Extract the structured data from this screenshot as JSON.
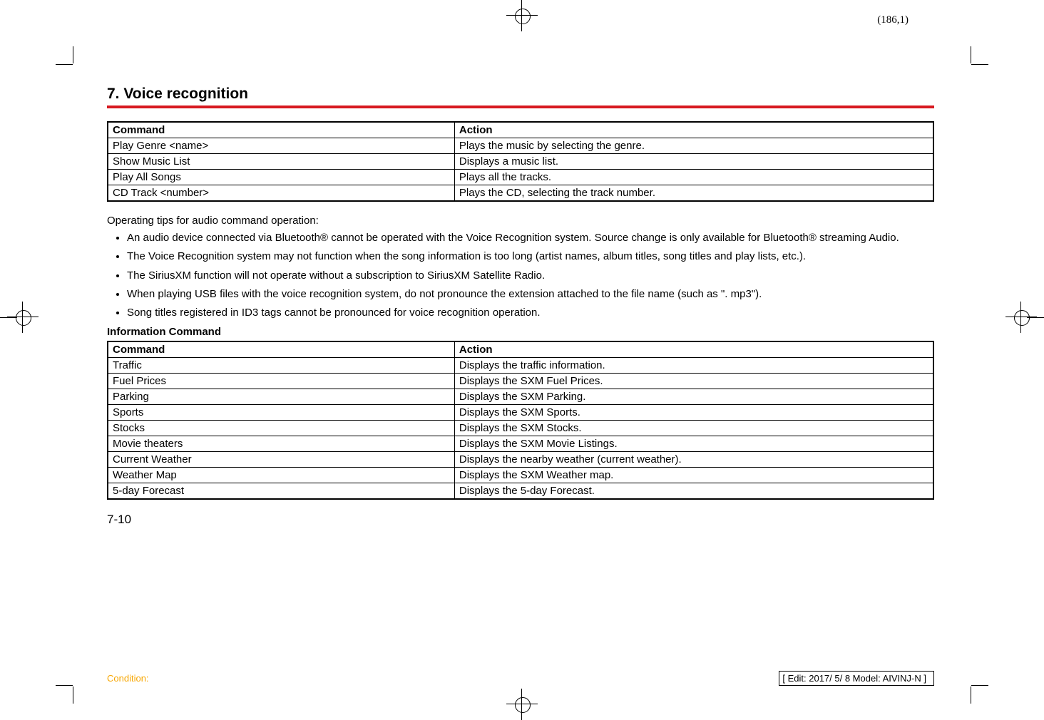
{
  "coord": "(186,1)",
  "section_title": "7. Voice recognition",
  "table1": {
    "headers": {
      "c1": "Command",
      "c2": "Action"
    },
    "rows": [
      {
        "c1": "Play Genre <name>",
        "c2": "Plays the music by selecting the genre."
      },
      {
        "c1": "Show Music List",
        "c2": "Displays a music list."
      },
      {
        "c1": "Play All Songs",
        "c2": "Plays all the tracks."
      },
      {
        "c1": "CD Track <number>",
        "c2": "Plays the CD, selecting the track number."
      }
    ]
  },
  "tips_intro": "Operating tips for audio command operation:",
  "tips": [
    "An audio device connected via Bluetooth® cannot be operated with the Voice Recognition system. Source change is only available for Bluetooth® streaming Audio.",
    "The Voice Recognition system may not function when the song information is too long (artist names, album titles, song titles and play lists, etc.).",
    "The SiriusXM function will not operate without a subscription to SiriusXM Satellite Radio.",
    "When playing USB files with the voice recognition system, do not pronounce the extension attached to the file name (such as \". mp3\").",
    "Song titles registered in ID3 tags cannot be pronounced for voice recognition operation."
  ],
  "info_heading": "Information Command",
  "table2": {
    "headers": {
      "c1": "Command",
      "c2": "Action"
    },
    "rows": [
      {
        "c1": "Traffic",
        "c2": "Displays the traffic information."
      },
      {
        "c1": "Fuel Prices",
        "c2": "Displays the SXM Fuel Prices."
      },
      {
        "c1": "Parking",
        "c2": "Displays the SXM Parking."
      },
      {
        "c1": "Sports",
        "c2": "Displays the SXM Sports."
      },
      {
        "c1": "Stocks",
        "c2": "Displays the SXM Stocks."
      },
      {
        "c1": "Movie theaters",
        "c2": "Displays the SXM Movie Listings."
      },
      {
        "c1": "Current Weather",
        "c2": "Displays the nearby weather (current weather)."
      },
      {
        "c1": "Weather Map",
        "c2": "Displays the SXM Weather map."
      },
      {
        "c1": "5-day Forecast",
        "c2": "Displays the 5-day Forecast."
      }
    ]
  },
  "page_num": "7-10",
  "footer": {
    "condition": "Condition:",
    "edit": "[ Edit: 2017/ 5/ 8   Model: AIVINJ-N ]"
  }
}
